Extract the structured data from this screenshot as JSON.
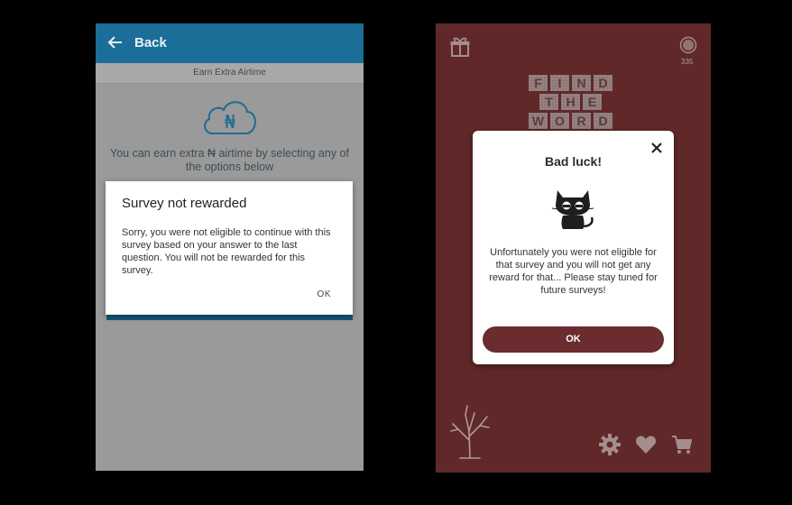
{
  "left": {
    "appbar": {
      "back_label": "Back"
    },
    "subheader": "Earn Extra Airtime",
    "description": "You can earn extra ₦ airtime by selecting any of the options below",
    "dialog": {
      "title": "Survey not rewarded",
      "body": "Sorry, you were not eligible to continue with this survey based on your answer to the last question. You will not be rewarded for this survey.",
      "ok_label": "OK"
    }
  },
  "right": {
    "coin_count": "335",
    "tiles": [
      [
        "F",
        "I",
        "N",
        "D"
      ],
      [
        "T",
        "H",
        "E"
      ],
      [
        "W",
        "O",
        "R",
        "D"
      ]
    ],
    "dialog": {
      "title": "Bad luck!",
      "body": "Unfortunately you were not eligible for that survey and you will not get any reward for that... Please stay tuned for future surveys!",
      "ok_label": "OK"
    }
  },
  "colors": {
    "left_appbar": "#1a6e97",
    "right_background": "#61282a",
    "ok_button": "#6b2c2f"
  },
  "icons": [
    "back-arrow-icon",
    "cloud-naira-icon",
    "gift-icon",
    "coin-icon",
    "close-icon",
    "cat-icon",
    "tree-icon",
    "gear-icon",
    "heart-icon",
    "cart-icon"
  ]
}
